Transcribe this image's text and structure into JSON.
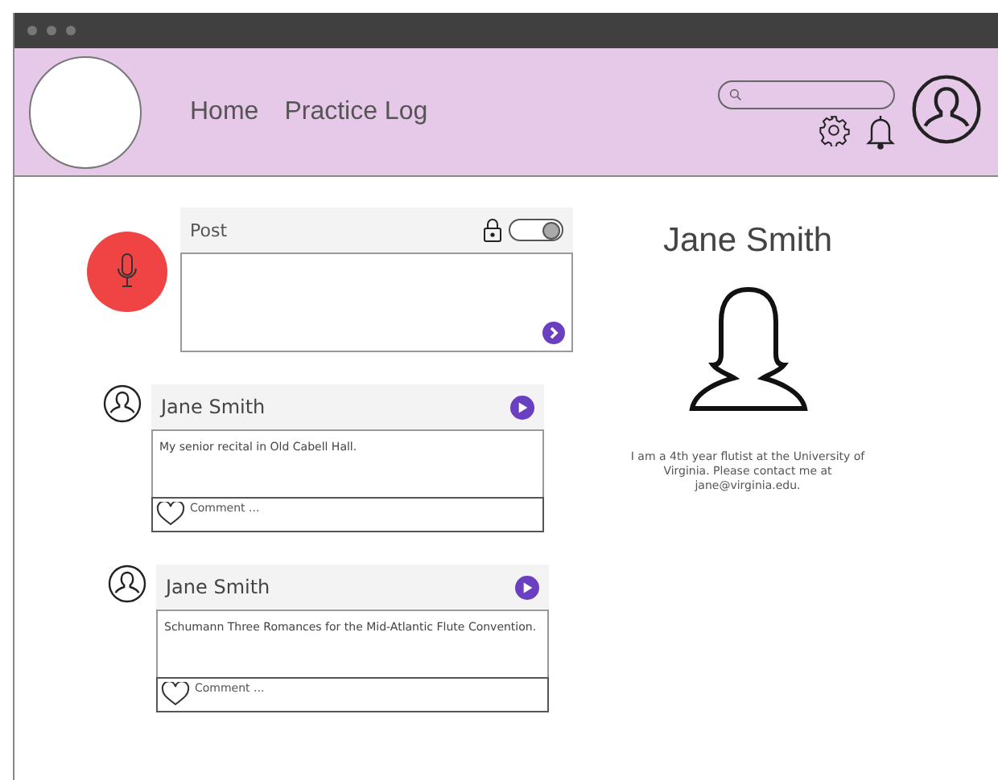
{
  "nav": [
    {
      "label": "Home"
    },
    {
      "label": "Practice Log"
    }
  ],
  "composer": {
    "label": "Post",
    "private_toggle": {
      "on": true
    }
  },
  "posts": [
    {
      "author": "Jane Smith",
      "text": "My senior recital in Old Cabell Hall.",
      "comment_placeholder": "Comment ..."
    },
    {
      "author": "Jane Smith",
      "text": "Schumann Three Romances for the Mid-Atlantic Flute Convention.",
      "comment_placeholder": "Comment ..."
    }
  ],
  "profile": {
    "name": "Jane Smith",
    "bio": "I am a 4th year flutist at the University of Virginia. Please contact me at jane@virginia.edu."
  }
}
